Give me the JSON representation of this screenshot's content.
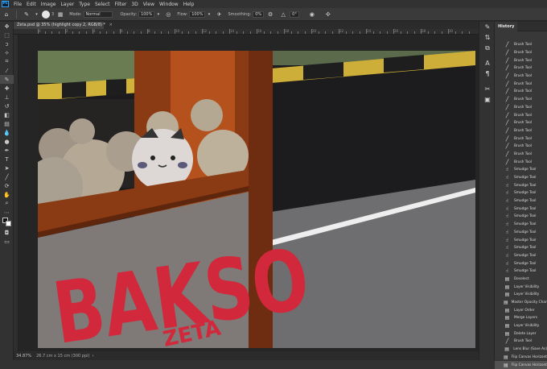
{
  "app": {
    "logo": "Ps"
  },
  "menu": [
    "File",
    "Edit",
    "Image",
    "Layer",
    "Type",
    "Select",
    "Filter",
    "3D",
    "View",
    "Window",
    "Help"
  ],
  "options": {
    "brush_size": "3",
    "mode_label": "Mode:",
    "mode_value": "Normal",
    "opacity_label": "Opacity:",
    "opacity_value": "100%",
    "flow_label": "Flow:",
    "flow_value": "100%",
    "smoothing_label": "Smoothing:",
    "smoothing_value": "0%",
    "angle_value": "0°"
  },
  "document": {
    "tab_title": "Zeta.psd @ 35% (highlight copy 2, RGB/8) *",
    "close_glyph": "×"
  },
  "ruler": {
    "numbers": [
      "0",
      "2",
      "4",
      "6",
      "8",
      "10",
      "12",
      "14",
      "16",
      "18",
      "20",
      "22",
      "24",
      "26",
      "28",
      "30"
    ]
  },
  "status": {
    "zoom": "34.87%",
    "doc_info": "26.7 cm x 15 cm (300 ppi)"
  },
  "history": {
    "tab_label": "History",
    "items": [
      {
        "label": "Brush Tool",
        "icon": "brush-icon"
      },
      {
        "label": "Brush Tool",
        "icon": "brush-icon"
      },
      {
        "label": "Brush Tool",
        "icon": "brush-icon"
      },
      {
        "label": "Brush Tool",
        "icon": "brush-icon"
      },
      {
        "label": "Brush Tool",
        "icon": "brush-icon"
      },
      {
        "label": "Brush Tool",
        "icon": "brush-icon"
      },
      {
        "label": "Brush Tool",
        "icon": "brush-icon"
      },
      {
        "label": "Brush Tool",
        "icon": "brush-icon"
      },
      {
        "label": "Brush Tool",
        "icon": "brush-icon"
      },
      {
        "label": "Brush Tool",
        "icon": "brush-icon"
      },
      {
        "label": "Brush Tool",
        "icon": "brush-icon"
      },
      {
        "label": "Brush Tool",
        "icon": "brush-icon"
      },
      {
        "label": "Brush Tool",
        "icon": "brush-icon"
      },
      {
        "label": "Brush Tool",
        "icon": "brush-icon"
      },
      {
        "label": "Brush Tool",
        "icon": "brush-icon"
      },
      {
        "label": "Brush Tool",
        "icon": "brush-icon"
      },
      {
        "label": "Smudge Tool",
        "icon": "smudge-icon"
      },
      {
        "label": "Smudge Tool",
        "icon": "smudge-icon"
      },
      {
        "label": "Smudge Tool",
        "icon": "smudge-icon"
      },
      {
        "label": "Smudge Tool",
        "icon": "smudge-icon"
      },
      {
        "label": "Smudge Tool",
        "icon": "smudge-icon"
      },
      {
        "label": "Smudge Tool",
        "icon": "smudge-icon"
      },
      {
        "label": "Smudge Tool",
        "icon": "smudge-icon"
      },
      {
        "label": "Smudge Tool",
        "icon": "smudge-icon"
      },
      {
        "label": "Smudge Tool",
        "icon": "smudge-icon"
      },
      {
        "label": "Smudge Tool",
        "icon": "smudge-icon"
      },
      {
        "label": "Smudge Tool",
        "icon": "smudge-icon"
      },
      {
        "label": "Smudge Tool",
        "icon": "smudge-icon"
      },
      {
        "label": "Smudge Tool",
        "icon": "smudge-icon"
      },
      {
        "label": "Smudge Tool",
        "icon": "smudge-icon"
      },
      {
        "label": "Deselect",
        "icon": "document-icon"
      },
      {
        "label": "Layer Visibility",
        "icon": "document-icon"
      },
      {
        "label": "Layer Visibility",
        "icon": "document-icon"
      },
      {
        "label": "Master Opacity Change",
        "icon": "document-icon"
      },
      {
        "label": "Layer Order",
        "icon": "document-icon"
      },
      {
        "label": "Merge Layers",
        "icon": "document-icon"
      },
      {
        "label": "Layer Visibility",
        "icon": "document-icon"
      },
      {
        "label": "Delete Layer",
        "icon": "document-icon"
      },
      {
        "label": "Brush Tool",
        "icon": "brush-icon"
      },
      {
        "label": "Lens Blur (Save As)",
        "icon": "document-icon"
      },
      {
        "label": "Flip Canvas Horizontal",
        "icon": "document-icon"
      },
      {
        "label": "Flip Canvas Horizontal",
        "icon": "document-icon",
        "current": true
      }
    ]
  },
  "artwork": {
    "sign_text": "BAKSO",
    "sub_text": "ZETA",
    "colors": {
      "lettering": "#d2283b",
      "wood": "#8a3b14",
      "sign_board": "#7d7775",
      "road": "#3a3a3a"
    }
  }
}
